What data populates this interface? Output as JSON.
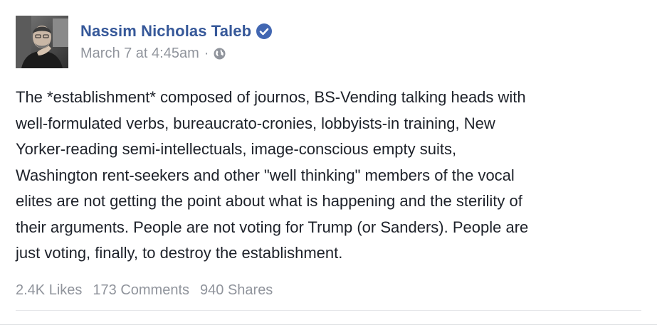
{
  "post": {
    "author": "Nassim Nicholas Taleb",
    "verified_icon": "verified-badge-icon",
    "timestamp": "March 7 at 4:45am",
    "separator": "·",
    "privacy_icon": "globe-icon",
    "text": "The *establishment* composed of journos, BS-Vending talking heads with\nwell-formulated verbs, bureaucrato-cronies, lobbyists-in training, New\nYorker-reading semi-intellectuals, image-conscious empty suits,\nWashington rent-seekers and other \"well thinking\" members of the vocal\nelites are not getting the point about what is happening and the sterility of\ntheir arguments. People are not voting for Trump (or Sanders). People are\njust voting, finally, to destroy the establishment."
  },
  "stats": {
    "likes": "2.4K Likes",
    "comments": "173 Comments",
    "shares": "940 Shares"
  },
  "colors": {
    "author_link": "#365899",
    "meta_text": "#90949c",
    "body_text": "#1d2129",
    "verified_badge": "#4267b2"
  }
}
